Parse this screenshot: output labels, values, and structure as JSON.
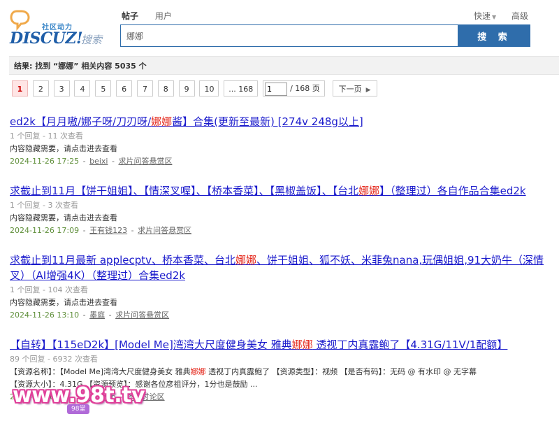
{
  "logo": {
    "tagline": "社区动力",
    "name": "DISCUZ!",
    "search_word": "搜索"
  },
  "tabs": [
    {
      "label": "帖子",
      "active": true
    },
    {
      "label": "用户",
      "active": false
    }
  ],
  "top_links": {
    "quick": "快速",
    "advanced": "高级"
  },
  "search": {
    "value": "娜娜",
    "button_label": "搜 索"
  },
  "result_summary": "结果: 找到 “娜娜” 相关内容 5035 个",
  "pager": {
    "pages": [
      "1",
      "2",
      "3",
      "4",
      "5",
      "6",
      "7",
      "8",
      "9",
      "10",
      "... 168"
    ],
    "current": "1",
    "jump_value": "1",
    "jump_total": "/ 168 页",
    "next_label": "下一页"
  },
  "results": [
    {
      "title_parts": [
        "ed2k【月月嗷/娜子呀/刀刃呀/",
        "娜娜",
        "酱】合集(更新至最新)  [274v 248g以上]"
      ],
      "counts": "1 个回复 - 11 次查看",
      "snippet_parts": [
        "内容隐藏需要，请点击进去查看",
        "",
        ""
      ],
      "date": "2024-11-26 17:25",
      "author": "beixi",
      "forum": "求片问答悬赏区"
    },
    {
      "title_parts": [
        "求截止到11月【饼干姐姐】、【情深叉喔】、【桥本香菜】、【黑椒盖饭】、【台北",
        "娜娜",
        "】（整理过）各自作品合集ed2k"
      ],
      "counts": "1 个回复 - 3 次查看",
      "snippet_parts": [
        "内容隐藏需要，请点击进去查看",
        "",
        ""
      ],
      "date": "2024-11-26 17:09",
      "author": "王有钱123",
      "forum": "求片问答悬赏区"
    },
    {
      "title_parts": [
        "求截止到11月最新 applecptv、桥本香菜、台北",
        "娜娜",
        "、饼干姐姐、狐不妖、米菲兔nana,玩偶姐姐,91大奶牛（深情叉）（AI增强4K）（整理过）合集ed2k"
      ],
      "counts": "1 个回复 - 104 次查看",
      "snippet_parts": [
        "内容隐藏需要，请点击进去查看",
        "",
        ""
      ],
      "date": "2024-11-26 13:10",
      "author": "墨庭",
      "forum": "求片问答悬赏区"
    },
    {
      "title_parts": [
        "【自转】【115eD2k】[Model Me]湾湾大尺度健身美女 雅典",
        "娜娜",
        " 透视丁内真露鲍了【4.31G/11V/1配额】"
      ],
      "counts": "89 个回复 - 6932 次查看",
      "snippet_parts": [
        "【资源名称】：【Model Me]湾湾大尺度健身美女 雅典",
        "娜娜",
        " 透视丁内真露鲍了 【资源类型】：视频 【是否有码】：无码 @ 有水印 @ 无字幕"
      ],
      "snippet_line2": "【资源大小】：4.31G 【资源预览】：感谢各位彦祖评分，1分也是鼓励 ...",
      "date": "2024-11-26 09:...",
      "author": "...ngvip",
      "forum": "综合讨论区"
    }
  ],
  "watermark": {
    "text": "www.98t.tv",
    "badge": "98堂"
  }
}
